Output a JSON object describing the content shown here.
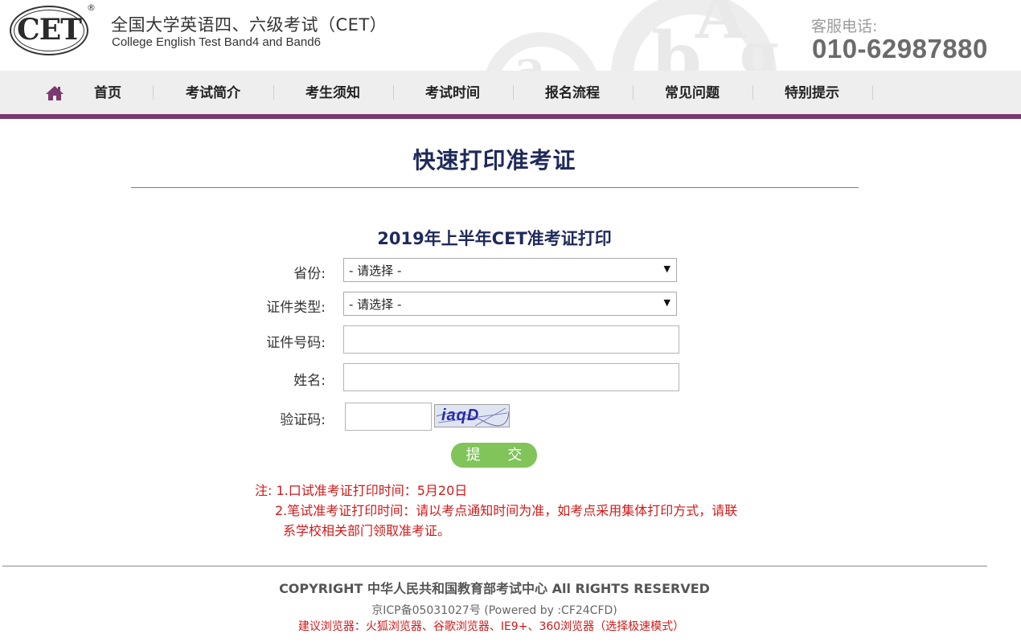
{
  "header": {
    "logo_text": "CET",
    "logo_registered": "®",
    "title_cn": "全国大学英语四、六级考试（CET）",
    "title_en": "College English Test Band4 and Band6",
    "hotline_label": "客服电话:",
    "hotline_number": "010-62987880"
  },
  "nav": {
    "items": [
      {
        "label": "首页"
      },
      {
        "label": "考试简介"
      },
      {
        "label": "考生须知"
      },
      {
        "label": "考试时间"
      },
      {
        "label": "报名流程"
      },
      {
        "label": "常见问题"
      },
      {
        "label": "特别提示"
      }
    ]
  },
  "main": {
    "page_title": "快速打印准考证",
    "form_title": "2019年上半年CET准考证打印",
    "fields": {
      "province": {
        "label": "省份:",
        "value": "- 请选择 -"
      },
      "id_type": {
        "label": "证件类型:",
        "value": "- 请选择 -"
      },
      "id_number": {
        "label": "证件号码:",
        "value": ""
      },
      "name": {
        "label": "姓名:",
        "value": ""
      },
      "captcha": {
        "label": "验证码:",
        "value": "",
        "image_text": "iaqD"
      }
    },
    "submit_label": "提 交",
    "notes": {
      "line1": "注: 1.口试准考证打印时间：5月20日",
      "line2": "2.笔试准考证打印时间：请以考点通知时间为准，如考点采用集体打印方式，请联",
      "line3": "系学校相关部门领取准考证。"
    }
  },
  "footer": {
    "copyright": "COPYRIGHT 中华人民共和国教育部考试中心 All RIGHTS RESERVED",
    "icp": "京ICP备05031027号 (Powered by :CF24CFD)",
    "browser_tip": "建议浏览器：火狐浏览器、谷歌浏览器、IE9+、360浏览器（选择极速模式）"
  },
  "colors": {
    "nav_accent": "#7a3a6e",
    "title": "#1f2a5a",
    "note_red": "#d11a1a",
    "submit_green": "#80c45a"
  }
}
